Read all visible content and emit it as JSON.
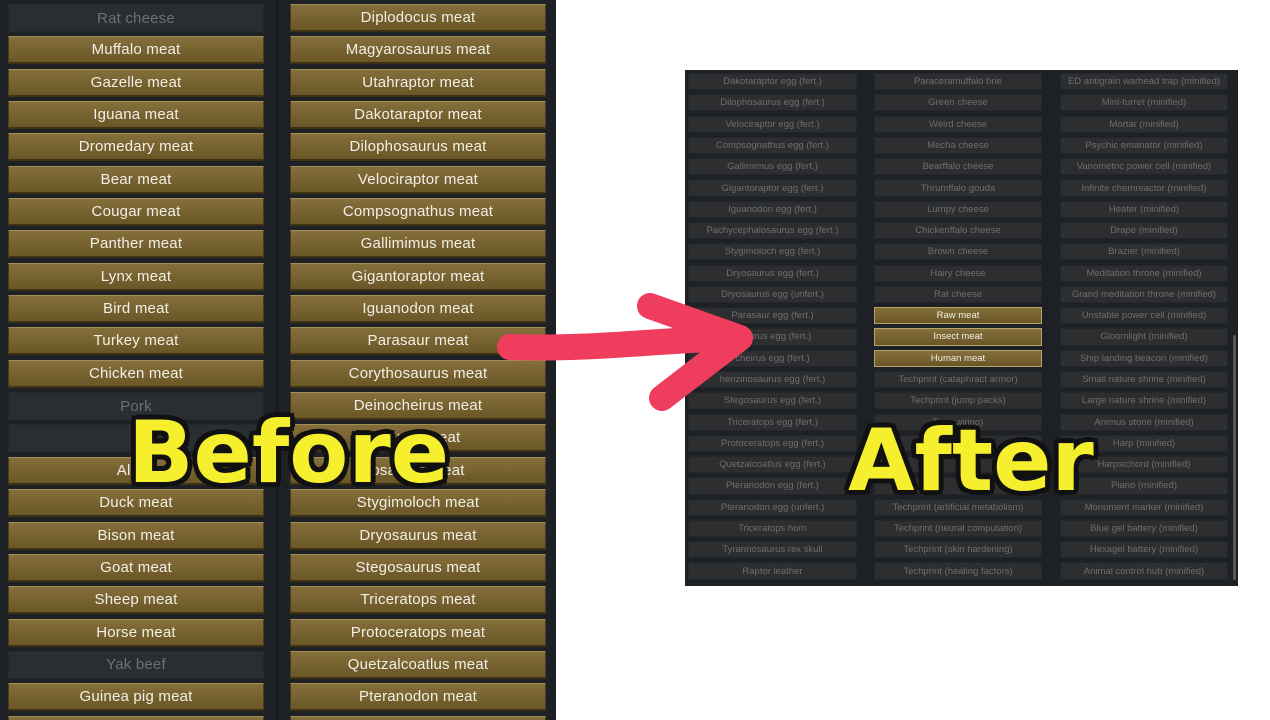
{
  "before": {
    "column1": [
      {
        "label": "Rat cheese",
        "enabled": false
      },
      {
        "label": "Muffalo meat",
        "enabled": true
      },
      {
        "label": "Gazelle meat",
        "enabled": true
      },
      {
        "label": "Iguana meat",
        "enabled": true
      },
      {
        "label": "Dromedary meat",
        "enabled": true
      },
      {
        "label": "Bear meat",
        "enabled": true
      },
      {
        "label": "Cougar meat",
        "enabled": true
      },
      {
        "label": "Panther meat",
        "enabled": true
      },
      {
        "label": "Lynx meat",
        "enabled": true
      },
      {
        "label": "Bird meat",
        "enabled": true
      },
      {
        "label": "Turkey meat",
        "enabled": true
      },
      {
        "label": "Chicken meat",
        "enabled": true
      },
      {
        "label": "Pork",
        "enabled": false
      },
      {
        "label": "B",
        "enabled": false
      },
      {
        "label": "Alpac",
        "enabled": true
      },
      {
        "label": "Duck meat",
        "enabled": true
      },
      {
        "label": "Bison meat",
        "enabled": true
      },
      {
        "label": "Goat meat",
        "enabled": true
      },
      {
        "label": "Sheep meat",
        "enabled": true
      },
      {
        "label": "Horse meat",
        "enabled": true
      },
      {
        "label": "Yak beef",
        "enabled": false
      },
      {
        "label": "Guinea pig meat",
        "enabled": true
      },
      {
        "label": "",
        "enabled": true
      }
    ],
    "column2": [
      {
        "label": "Diplodocus meat",
        "enabled": true
      },
      {
        "label": "Magyarosaurus meat",
        "enabled": true
      },
      {
        "label": "Utahraptor meat",
        "enabled": true
      },
      {
        "label": "Dakotaraptor meat",
        "enabled": true
      },
      {
        "label": "Dilophosaurus meat",
        "enabled": true
      },
      {
        "label": "Velociraptor meat",
        "enabled": true
      },
      {
        "label": "Compsognathus meat",
        "enabled": true
      },
      {
        "label": "Gallimimus meat",
        "enabled": true
      },
      {
        "label": "Gigantoraptor meat",
        "enabled": true
      },
      {
        "label": "Iguanodon meat",
        "enabled": true
      },
      {
        "label": "Parasaur meat",
        "enabled": true
      },
      {
        "label": "Corythosaurus meat",
        "enabled": true
      },
      {
        "label": "Deinocheirus meat",
        "enabled": true
      },
      {
        "label": "saurus meat",
        "enabled": true
      },
      {
        "label": "osaurus meat",
        "enabled": true
      },
      {
        "label": "Stygimoloch meat",
        "enabled": true
      },
      {
        "label": "Dryosaurus meat",
        "enabled": true
      },
      {
        "label": "Stegosaurus meat",
        "enabled": true
      },
      {
        "label": "Triceratops meat",
        "enabled": true
      },
      {
        "label": "Protoceratops meat",
        "enabled": true
      },
      {
        "label": "Quetzalcoatlus meat",
        "enabled": true
      },
      {
        "label": "Pteranodon meat",
        "enabled": true
      },
      {
        "label": "",
        "enabled": true
      }
    ]
  },
  "after": {
    "column1": [
      {
        "label": "Dakotaraptor egg (fert.)",
        "enabled": false
      },
      {
        "label": "Dilophosaurus egg (fert.)",
        "enabled": false
      },
      {
        "label": "Velociraptor egg (fert.)",
        "enabled": false
      },
      {
        "label": "Compsognathus egg (fert.)",
        "enabled": false
      },
      {
        "label": "Gallimimus egg (fert.)",
        "enabled": false
      },
      {
        "label": "Gigantoraptor egg (fert.)",
        "enabled": false
      },
      {
        "label": "Iguanodon egg (fert.)",
        "enabled": false
      },
      {
        "label": "Pachycephalosaurus egg (fert.)",
        "enabled": false
      },
      {
        "label": "Stygimoloch egg (fert.)",
        "enabled": false
      },
      {
        "label": "Dryosaurus egg (fert.)",
        "enabled": false
      },
      {
        "label": "Dryosaurus egg (unfert.)",
        "enabled": false
      },
      {
        "label": "Parasaur egg (fert.)",
        "enabled": false
      },
      {
        "label": "osaurus egg (fert.)",
        "enabled": false
      },
      {
        "label": "cheirus egg (fert.)",
        "enabled": false
      },
      {
        "label": "herizinosaurus egg (fert.)",
        "enabled": false
      },
      {
        "label": "Stegosaurus egg (fert.)",
        "enabled": false
      },
      {
        "label": "Triceratops egg (fert.)",
        "enabled": false
      },
      {
        "label": "Protoceratops egg (fert.)",
        "enabled": false
      },
      {
        "label": "Quetzalcoatlus egg (fert.)",
        "enabled": false
      },
      {
        "label": "Pteranodon egg (fert.)",
        "enabled": false
      },
      {
        "label": "Pteranodon egg (unfert.)",
        "enabled": false
      },
      {
        "label": "Triceratops horn",
        "enabled": false
      },
      {
        "label": "Tyrannosaurus rex skull",
        "enabled": false
      },
      {
        "label": "Raptor leather",
        "enabled": false
      }
    ],
    "column2": [
      {
        "label": "Paraceramuffalo brie",
        "enabled": false
      },
      {
        "label": "Green cheese",
        "enabled": false
      },
      {
        "label": "Weird cheese",
        "enabled": false
      },
      {
        "label": "Mecha cheese",
        "enabled": false
      },
      {
        "label": "Bearffalo cheese",
        "enabled": false
      },
      {
        "label": "Thrumffalo gouda",
        "enabled": false
      },
      {
        "label": "Lumpy cheese",
        "enabled": false
      },
      {
        "label": "Chickenffalo cheese",
        "enabled": false
      },
      {
        "label": "Brown cheese",
        "enabled": false
      },
      {
        "label": "Hairy cheese",
        "enabled": false
      },
      {
        "label": "Rat cheese",
        "enabled": false
      },
      {
        "label": "Raw meat",
        "enabled": true
      },
      {
        "label": "Insect meat",
        "enabled": true
      },
      {
        "label": "Human meat",
        "enabled": true
      },
      {
        "label": "Techprint (cataphract armor)",
        "enabled": false
      },
      {
        "label": "Techprint (jump packs)",
        "enabled": false
      },
      {
        "label": "Te           in wiring)",
        "enabled": false
      },
      {
        "label": "",
        "enabled": false
      },
      {
        "label": "",
        "enabled": false
      },
      {
        "label": "",
        "enabled": false
      },
      {
        "label": "Techprint (artificial metabolism)",
        "enabled": false
      },
      {
        "label": "Techprint (neural computation)",
        "enabled": false
      },
      {
        "label": "Techprint (skin hardening)",
        "enabled": false
      },
      {
        "label": "Techprint (healing factors)",
        "enabled": false
      }
    ],
    "column3": [
      {
        "label": "ED antigrain warhead trap (minified)",
        "enabled": false
      },
      {
        "label": "Mini-turret (minified)",
        "enabled": false
      },
      {
        "label": "Mortar (minified)",
        "enabled": false
      },
      {
        "label": "Psychic emanator (minified)",
        "enabled": false
      },
      {
        "label": "Vanometric power cell (minified)",
        "enabled": false
      },
      {
        "label": "Infinite chemreactor (minified)",
        "enabled": false
      },
      {
        "label": "Heater (minified)",
        "enabled": false
      },
      {
        "label": "Drape (minified)",
        "enabled": false
      },
      {
        "label": "Brazier (minified)",
        "enabled": false
      },
      {
        "label": "Meditation throne (minified)",
        "enabled": false
      },
      {
        "label": "Grand meditation throne (minified)",
        "enabled": false
      },
      {
        "label": "Unstable power cell (minified)",
        "enabled": false
      },
      {
        "label": "Gloomlight (minified)",
        "enabled": false
      },
      {
        "label": "Ship landing beacon (minified)",
        "enabled": false
      },
      {
        "label": "Small nature shrine (minified)",
        "enabled": false
      },
      {
        "label": "Large nature shrine (minified)",
        "enabled": false
      },
      {
        "label": "Animus stone (minified)",
        "enabled": false
      },
      {
        "label": "Harp (minified)",
        "enabled": false
      },
      {
        "label": "Harpsichord (minified)",
        "enabled": false
      },
      {
        "label": "Piano (minified)",
        "enabled": false
      },
      {
        "label": "Monument marker (minified)",
        "enabled": false
      },
      {
        "label": "Blue gel battery (minified)",
        "enabled": false
      },
      {
        "label": "Hexagel battery (minified)",
        "enabled": false
      },
      {
        "label": "Animal control hub (minified)",
        "enabled": false
      }
    ]
  },
  "captions": {
    "before": "Before",
    "after": "After"
  },
  "colors": {
    "caption": "#f5ef2e",
    "arrow": "#ef3d5e",
    "enabled_button": "#7a6431",
    "disabled_button": "#2c2e30",
    "panel_bg": "#1d2126"
  }
}
